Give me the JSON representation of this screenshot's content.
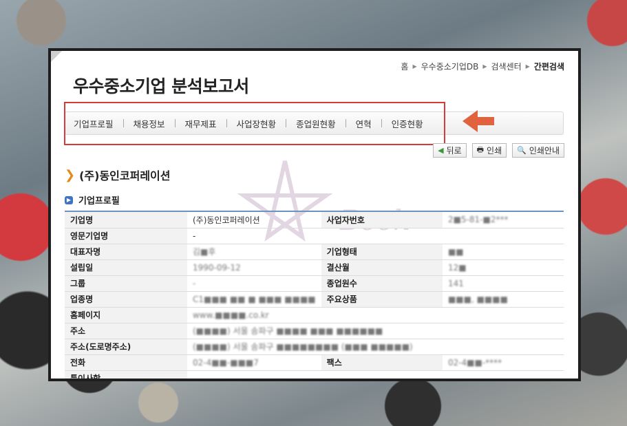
{
  "breadcrumb": {
    "items": [
      "홈",
      "우수중소기업DB",
      "검색센터",
      "간편검색"
    ]
  },
  "page_title": "우수중소기업 분석보고서",
  "tabs": [
    "기업프로필",
    "채용정보",
    "재무제표",
    "사업장현황",
    "종업원현황",
    "연혁",
    "인증현황"
  ],
  "actions": {
    "back": "뒤로",
    "print": "인쇄",
    "print_guide": "인쇄안내"
  },
  "company_name": "(주)동인코퍼레이션",
  "section_title": "기업프로필",
  "watermark_text": "Book",
  "profile": {
    "rows": [
      {
        "l1": "기업명",
        "v1": "(주)동인코퍼레이션",
        "l2": "사업자번호",
        "v2": "2■5-81-■2***"
      },
      {
        "l1": "영문기업명",
        "v1": "-",
        "l2": "",
        "v2": ""
      },
      {
        "l1": "대표자명",
        "v1": "김■후",
        "l2": "기업형태",
        "v2": "■■"
      },
      {
        "l1": "설립일",
        "v1": "1990-09-12",
        "l2": "결산월",
        "v2": "12■"
      },
      {
        "l1": "그룹",
        "v1": "-",
        "l2": "종업원수",
        "v2": "141"
      },
      {
        "l1": "업종명",
        "v1": "C1■■■ ■■ ■ ■■■ ■■■■",
        "l2": "주요상품",
        "v2": "■■■, ■■■■"
      },
      {
        "l1": "홈페이지",
        "v1": "www.■■■■.co.kr",
        "l2": "",
        "v2": ""
      },
      {
        "l1": "주소",
        "v1": "(■■■■) 서울 송파구 ■■■■ ■■■ ■■■■■■",
        "l2": "",
        "v2": ""
      },
      {
        "l1": "주소(도로명주소)",
        "v1": "(■■■■) 서울 송파구 ■■■■■■■■ (■■■ ■■■■■)",
        "l2": "",
        "v2": ""
      },
      {
        "l1": "전화",
        "v1": "02-4■■-■■■7",
        "l2": "팩스",
        "v2": "02-4■■-****"
      },
      {
        "l1": "특이사항",
        "v1": "-",
        "l2": "",
        "v2": ""
      }
    ]
  },
  "colors": {
    "highlight": "#d83a3a",
    "arrow": "#e0623e",
    "table_top": "#6e92bd",
    "chevron": "#e08a1a"
  }
}
